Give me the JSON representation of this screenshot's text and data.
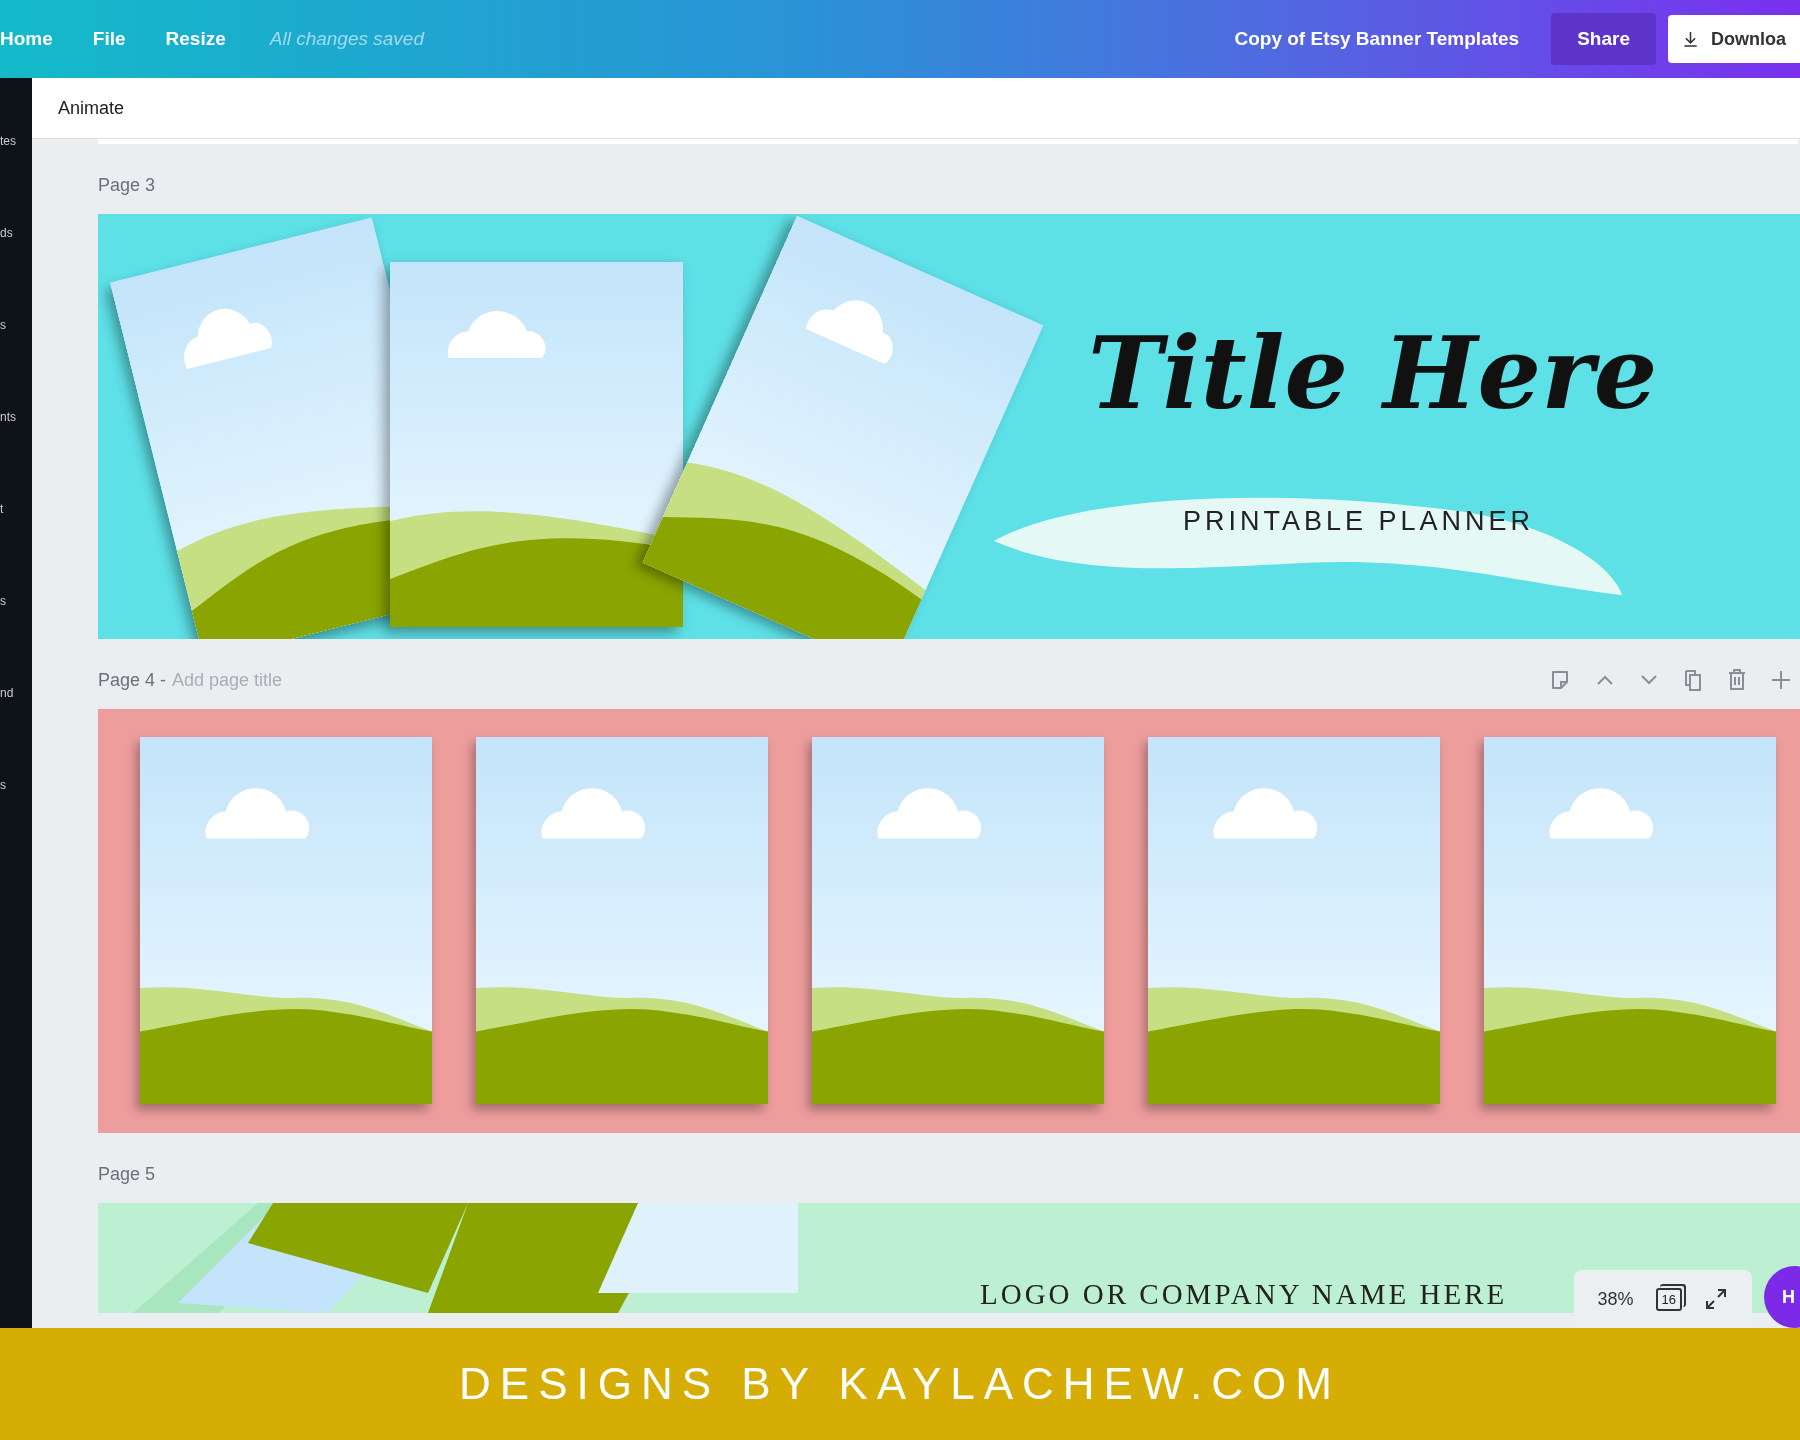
{
  "topbar": {
    "menu": [
      {
        "label": "Home"
      },
      {
        "label": "File"
      },
      {
        "label": "Resize"
      }
    ],
    "save_status": "All changes saved",
    "design_title": "Copy of Etsy Banner Templates",
    "share": "Share",
    "download": "Downloa"
  },
  "sidebar": {
    "items": [
      "tes",
      "ds",
      "s",
      "nts",
      "t",
      "s",
      "nd",
      "s"
    ]
  },
  "toolbar": {
    "animate": "Animate"
  },
  "pages": [
    {
      "kind": "collage",
      "label": "Page 3",
      "title": "Title Here",
      "subtitle": "PRINTABLE PLANNER"
    },
    {
      "kind": "strip",
      "label": "Page 4 -",
      "title_placeholder": "Add page title",
      "show_actions": true
    },
    {
      "kind": "logo",
      "label": "Page 5",
      "text": "LOGO OR COMPANY NAME HERE"
    }
  ],
  "zoom_controls": {
    "zoom": "38%",
    "page_count": "16"
  },
  "help_button": "H",
  "footer_banner": "DESIGNS BY KAYLACHEW.COM"
}
